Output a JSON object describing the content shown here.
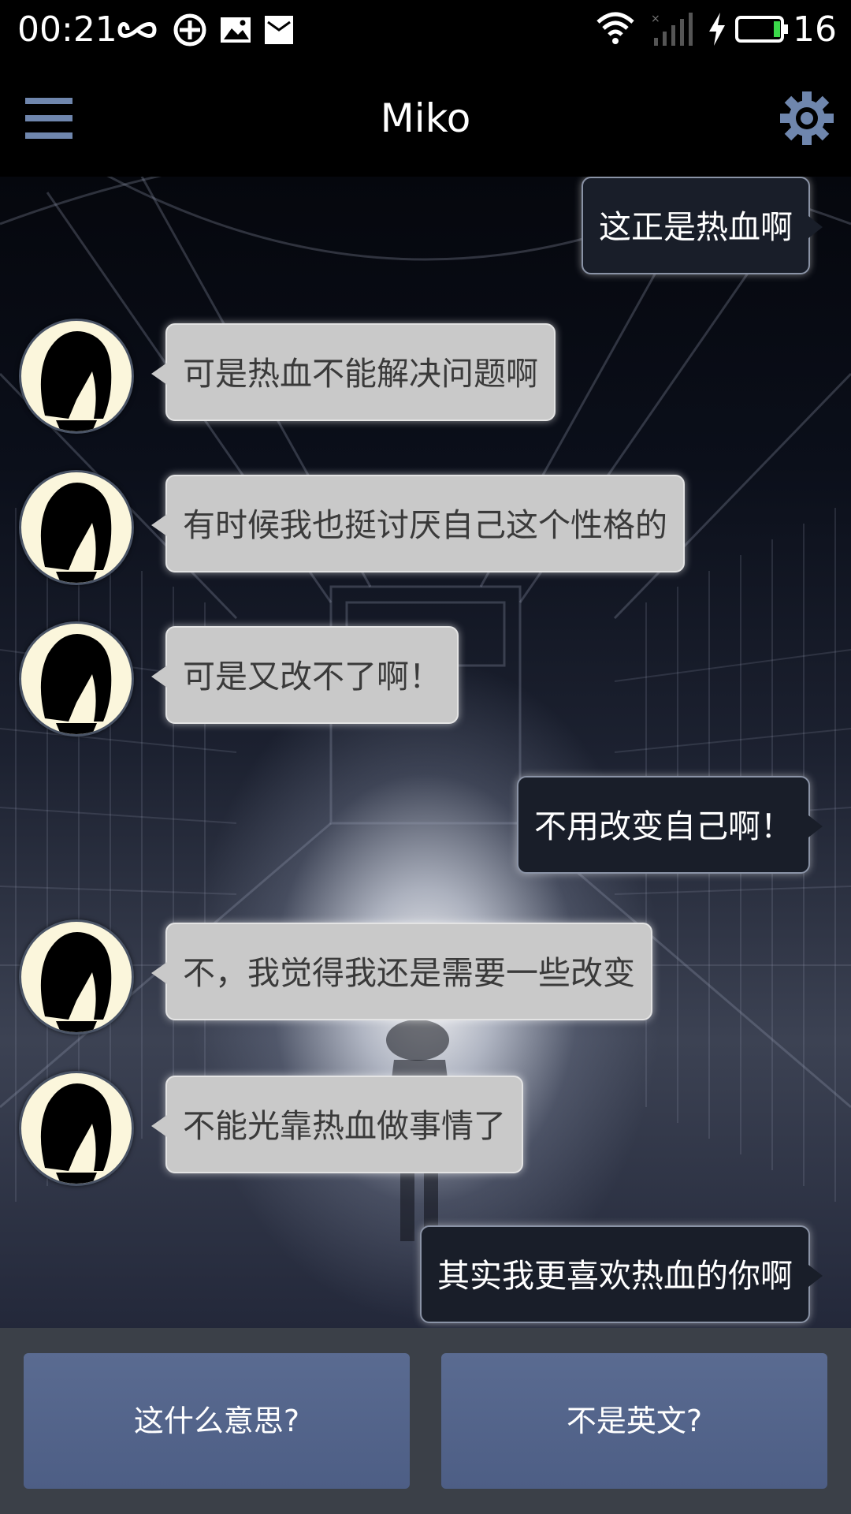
{
  "status_bar": {
    "time": "00:21",
    "battery_level": "16",
    "icons": [
      "infinity-icon",
      "sync-icon",
      "image-icon",
      "mail-icon",
      "wifi-icon",
      "signal-icon",
      "charging-icon",
      "battery-icon"
    ]
  },
  "app_bar": {
    "title": "Miko",
    "menu_icon": "hamburger-menu-icon",
    "settings_icon": "gear-icon"
  },
  "chat": {
    "messages": [
      {
        "sender": "user",
        "text": "这正是热血啊"
      },
      {
        "sender": "bot",
        "text": "可是热血不能解决问题啊"
      },
      {
        "sender": "bot",
        "text": "有时候我也挺讨厌自己这个性格的"
      },
      {
        "sender": "bot",
        "text": "可是又改不了啊！"
      },
      {
        "sender": "user",
        "text": "不用改变自己啊！"
      },
      {
        "sender": "bot",
        "text": "不，我觉得我还是需要一些改变"
      },
      {
        "sender": "bot",
        "text": "不能光靠热血做事情了"
      },
      {
        "sender": "user",
        "text": "其实我更喜欢热血的你啊"
      }
    ]
  },
  "options": {
    "left_label": "这什么意思?",
    "right_label": "不是英文?"
  },
  "colors": {
    "user_bubble": "#191e29",
    "bot_bubble": "#c9c9c9",
    "option_button": "#556790",
    "options_bar": "#3b4048",
    "accent_icon": "#6f86ad"
  }
}
